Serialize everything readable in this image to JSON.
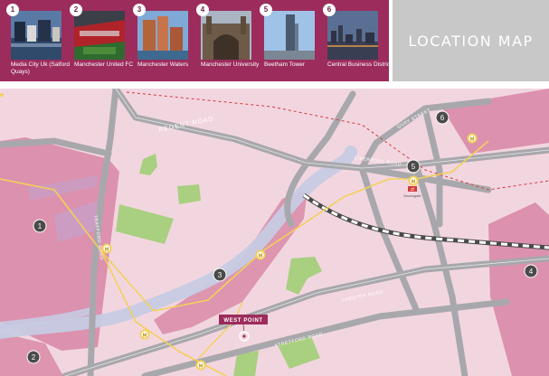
{
  "locations": [
    {
      "number": "1",
      "caption": "Media City Uk (Salford Quays)"
    },
    {
      "number": "2",
      "caption": "Manchester United FC"
    },
    {
      "number": "3",
      "caption": "Manchester Waters"
    },
    {
      "number": "4",
      "caption": "Manchester University"
    },
    {
      "number": "5",
      "caption": "Beetham Tower"
    },
    {
      "number": "6",
      "caption": "Central Business District"
    }
  ],
  "title": "LOCATION MAP",
  "map": {
    "roads": [
      "REGENT ROAD",
      "LIVERPOOL ROAD",
      "CHESTER ROAD",
      "TRAFFORD ROAD",
      "STRETFORD ROAD",
      "QUAY STREET"
    ],
    "station_label": "Deansgate",
    "rail_symbol": "⇄",
    "development_label": "WEST POINT",
    "tram_symbol": "M",
    "markers": [
      "1",
      "2",
      "3",
      "4",
      "5",
      "6"
    ]
  },
  "colors": {
    "header": "#9c2c5c",
    "title_panel": "#c8c8c8",
    "map_background": "#f2d6df",
    "road": "#a8a8ac",
    "district": "#d98aa8",
    "water": "#c6cbe3",
    "park": "#a9cf80",
    "tram_route": "#f3d05a",
    "rail_line": "#d23c3c"
  }
}
